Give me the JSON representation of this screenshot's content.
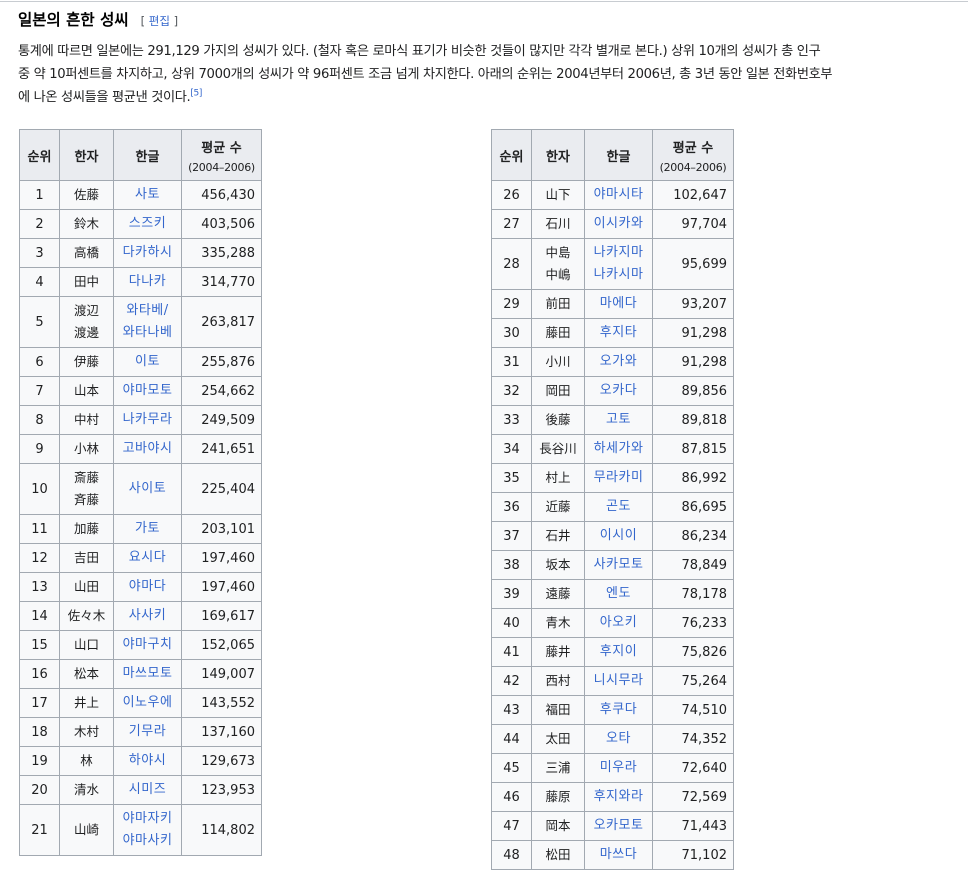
{
  "section": {
    "title": "일본의 흔한 성씨",
    "edit_open": "[",
    "edit_label": "편집",
    "edit_close": "]"
  },
  "intro": {
    "line1": "통계에 따르면 일본에는 291,129 가지의 성씨가 있다. (철자 혹은 로마식 표기가 비슷한 것들이 많지만 각각 별개로 본다.) 상위 10개의 성씨가 총 인구",
    "line2": "중 약 10퍼센트를 차지하고, 상위 7000개의 성씨가 약 96퍼센트 조금 넘게 차지한다. 아래의 순위는 2004년부터 2006년, 총 3년 동안 일본 전화번호부",
    "line3": "에 나온 성씨들을 평균낸 것이다.",
    "footnote": "[5]"
  },
  "table": {
    "headers": {
      "rank": "순위",
      "hanja": "한자",
      "hangul": "한글",
      "count": "평균 수",
      "count_sub": "(2004–2006)"
    },
    "left_rows": [
      {
        "rank": "1",
        "hanja": [
          "佐藤"
        ],
        "hangul": [
          "사토"
        ],
        "count": "456,430"
      },
      {
        "rank": "2",
        "hanja": [
          "鈴木"
        ],
        "hangul": [
          "스즈키"
        ],
        "count": "403,506"
      },
      {
        "rank": "3",
        "hanja": [
          "高橋"
        ],
        "hangul": [
          "다카하시"
        ],
        "count": "335,288"
      },
      {
        "rank": "4",
        "hanja": [
          "田中"
        ],
        "hangul": [
          "다나카"
        ],
        "count": "314,770"
      },
      {
        "rank": "5",
        "hanja": [
          "渡辺",
          "渡邊"
        ],
        "hangul": [
          "와타베/",
          "와타나베"
        ],
        "count": "263,817"
      },
      {
        "rank": "6",
        "hanja": [
          "伊藤"
        ],
        "hangul": [
          "이토"
        ],
        "count": "255,876"
      },
      {
        "rank": "7",
        "hanja": [
          "山本"
        ],
        "hangul": [
          "야마모토"
        ],
        "count": "254,662"
      },
      {
        "rank": "8",
        "hanja": [
          "中村"
        ],
        "hangul": [
          "나카무라"
        ],
        "count": "249,509"
      },
      {
        "rank": "9",
        "hanja": [
          "小林"
        ],
        "hangul": [
          "고바야시"
        ],
        "count": "241,651"
      },
      {
        "rank": "10",
        "hanja": [
          "斎藤",
          "斉藤"
        ],
        "hangul": [
          "사이토"
        ],
        "count": "225,404"
      },
      {
        "rank": "11",
        "hanja": [
          "加藤"
        ],
        "hangul": [
          "가토"
        ],
        "count": "203,101"
      },
      {
        "rank": "12",
        "hanja": [
          "吉田"
        ],
        "hangul": [
          "요시다"
        ],
        "count": "197,460"
      },
      {
        "rank": "13",
        "hanja": [
          "山田"
        ],
        "hangul": [
          "야마다"
        ],
        "count": "197,460"
      },
      {
        "rank": "14",
        "hanja": [
          "佐々木"
        ],
        "hangul": [
          "사사키"
        ],
        "count": "169,617"
      },
      {
        "rank": "15",
        "hanja": [
          "山口"
        ],
        "hangul": [
          "야마구치"
        ],
        "count": "152,065"
      },
      {
        "rank": "16",
        "hanja": [
          "松本"
        ],
        "hangul": [
          "마쓰모토"
        ],
        "count": "149,007"
      },
      {
        "rank": "17",
        "hanja": [
          "井上"
        ],
        "hangul": [
          "이노우에"
        ],
        "count": "143,552"
      },
      {
        "rank": "18",
        "hanja": [
          "木村"
        ],
        "hangul": [
          "기무라"
        ],
        "count": "137,160"
      },
      {
        "rank": "19",
        "hanja": [
          "林"
        ],
        "hangul": [
          "하야시"
        ],
        "count": "129,673"
      },
      {
        "rank": "20",
        "hanja": [
          "清水"
        ],
        "hangul": [
          "시미즈"
        ],
        "count": "123,953"
      },
      {
        "rank": "21",
        "hanja": [
          "山崎"
        ],
        "hangul": [
          "야마자키",
          "야마사키"
        ],
        "count": "114,802"
      }
    ],
    "right_rows": [
      {
        "rank": "26",
        "hanja": [
          "山下"
        ],
        "hangul": [
          "야마시타"
        ],
        "count": "102,647"
      },
      {
        "rank": "27",
        "hanja": [
          "石川"
        ],
        "hangul": [
          "이시카와"
        ],
        "count": "97,704"
      },
      {
        "rank": "28",
        "hanja": [
          "中島",
          "中嶋"
        ],
        "hangul": [
          "나카지마",
          "나카시마"
        ],
        "count": "95,699"
      },
      {
        "rank": "29",
        "hanja": [
          "前田"
        ],
        "hangul": [
          "마에다"
        ],
        "count": "93,207"
      },
      {
        "rank": "30",
        "hanja": [
          "藤田"
        ],
        "hangul": [
          "후지타"
        ],
        "count": "91,298"
      },
      {
        "rank": "31",
        "hanja": [
          "小川"
        ],
        "hangul": [
          "오가와"
        ],
        "count": "91,298"
      },
      {
        "rank": "32",
        "hanja": [
          "岡田"
        ],
        "hangul": [
          "오카다"
        ],
        "count": "89,856"
      },
      {
        "rank": "33",
        "hanja": [
          "後藤"
        ],
        "hangul": [
          "고토"
        ],
        "count": "89,818"
      },
      {
        "rank": "34",
        "hanja": [
          "長谷川"
        ],
        "hangul": [
          "하세가와"
        ],
        "count": "87,815"
      },
      {
        "rank": "35",
        "hanja": [
          "村上"
        ],
        "hangul": [
          "무라카미"
        ],
        "count": "86,992"
      },
      {
        "rank": "36",
        "hanja": [
          "近藤"
        ],
        "hangul": [
          "곤도"
        ],
        "count": "86,695"
      },
      {
        "rank": "37",
        "hanja": [
          "石井"
        ],
        "hangul": [
          "이시이"
        ],
        "count": "86,234"
      },
      {
        "rank": "38",
        "hanja": [
          "坂本"
        ],
        "hangul": [
          "사카모토"
        ],
        "count": "78,849"
      },
      {
        "rank": "39",
        "hanja": [
          "遠藤"
        ],
        "hangul": [
          "엔도"
        ],
        "count": "78,178"
      },
      {
        "rank": "40",
        "hanja": [
          "青木"
        ],
        "hangul": [
          "아오키"
        ],
        "count": "76,233"
      },
      {
        "rank": "41",
        "hanja": [
          "藤井"
        ],
        "hangul": [
          "후지이"
        ],
        "count": "75,826"
      },
      {
        "rank": "42",
        "hanja": [
          "西村"
        ],
        "hangul": [
          "니시무라"
        ],
        "count": "75,264"
      },
      {
        "rank": "43",
        "hanja": [
          "福田"
        ],
        "hangul": [
          "후쿠다"
        ],
        "count": "74,510"
      },
      {
        "rank": "44",
        "hanja": [
          "太田"
        ],
        "hangul": [
          "오타"
        ],
        "count": "74,352"
      },
      {
        "rank": "45",
        "hanja": [
          "三浦"
        ],
        "hangul": [
          "미우라"
        ],
        "count": "72,640"
      },
      {
        "rank": "46",
        "hanja": [
          "藤原"
        ],
        "hangul": [
          "후지와라"
        ],
        "count": "72,569"
      },
      {
        "rank": "47",
        "hanja": [
          "岡本"
        ],
        "hangul": [
          "오카모토"
        ],
        "count": "71,443"
      },
      {
        "rank": "48",
        "hanja": [
          "松田"
        ],
        "hangul": [
          "마쓰다"
        ],
        "count": "71,102"
      }
    ]
  },
  "colors": {
    "link": "#3366cc",
    "header_bg": "#eaecf0",
    "cell_bg": "#f8f9fa",
    "border": "#a2a9b1"
  }
}
